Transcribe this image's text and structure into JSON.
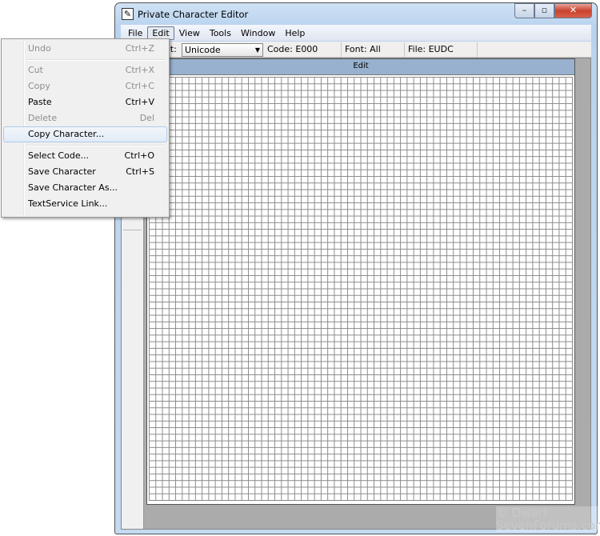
{
  "window": {
    "title": "Private Character Editor",
    "icon": "pen-icon",
    "controls": {
      "minimize": "–",
      "maximize": "▫",
      "close": "✕"
    }
  },
  "menubar": [
    "File",
    "Edit",
    "View",
    "Tools",
    "Window",
    "Help"
  ],
  "toolbar": {
    "charset_label_partial": "et:",
    "charset_value": "Unicode",
    "code": "Code: E000",
    "font": "Font: All",
    "file": "File: EUDC"
  },
  "edit_window": {
    "title": "Edit"
  },
  "edit_menu": {
    "items": [
      {
        "label": "Undo",
        "shortcut": "Ctrl+Z",
        "disabled": true
      },
      {
        "label": "Cut",
        "shortcut": "Ctrl+X",
        "disabled": true
      },
      {
        "label": "Copy",
        "shortcut": "Ctrl+C",
        "disabled": true
      },
      {
        "label": "Paste",
        "shortcut": "Ctrl+V",
        "disabled": false
      },
      {
        "label": "Delete",
        "shortcut": "Del",
        "disabled": true
      },
      {
        "label": "Copy Character...",
        "shortcut": "",
        "highlighted": true
      },
      {
        "label": "Select Code...",
        "shortcut": "Ctrl+O"
      },
      {
        "label": "Save Character",
        "shortcut": "Ctrl+S"
      },
      {
        "label": "Save Character As...",
        "shortcut": ""
      },
      {
        "label": "TextService Link...",
        "shortcut": ""
      }
    ]
  },
  "watermark": {
    "line1": "© Dwarf",
    "line2": "SevenForums.com"
  }
}
